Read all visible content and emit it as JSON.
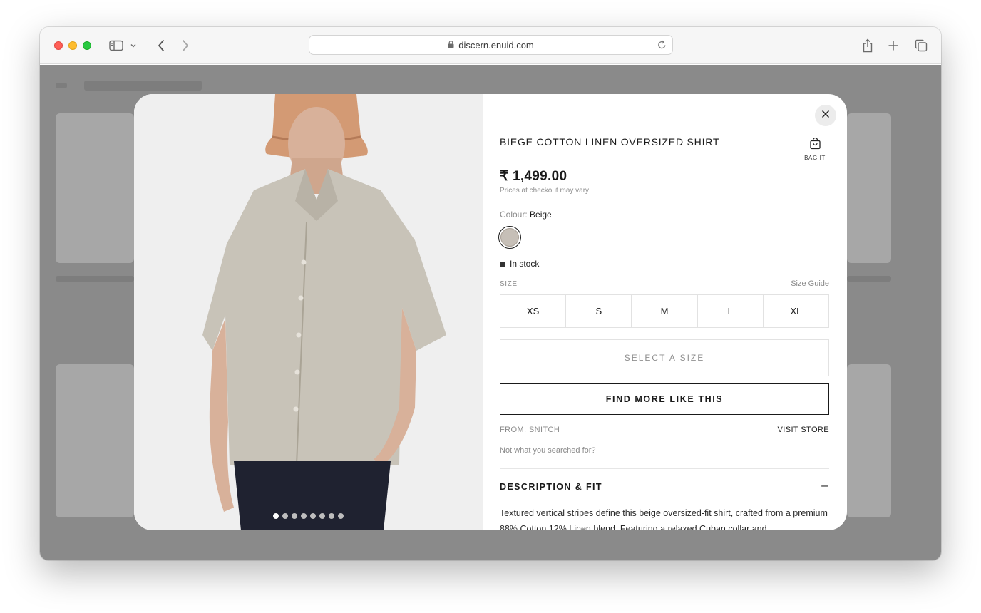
{
  "browser": {
    "url": "discern.enuid.com"
  },
  "product": {
    "title": "BIEGE COTTON LINEN OVERSIZED SHIRT",
    "bag_label": "BAG IT",
    "price": "₹ 1,499.00",
    "price_note": "Prices at checkout may vary",
    "colour_label": "Colour:",
    "colour_value": "Beige",
    "swatch_color": "#c6bfb7",
    "stock": "In stock",
    "size_label": "SIZE",
    "size_guide": "Size Guide",
    "sizes": [
      "XS",
      "S",
      "M",
      "L",
      "XL"
    ],
    "select_size": "SELECT A SIZE",
    "find_more": "FIND MORE LIKE THIS",
    "from": "FROM: SNITCH",
    "visit_store": "VISIT STORE",
    "not_what": "Not what you searched for?",
    "description_heading": "DESCRIPTION & FIT",
    "description_toggle": "–",
    "description": "Textured vertical stripes define this beige oversized-fit shirt, crafted from a premium 88% Cotton 12% Linen blend. Featuring a relaxed Cuban collar and",
    "image_count": 8,
    "active_image": 1
  },
  "icons": {
    "sidebar": "sidebar-icon",
    "back": "chevron-left-icon",
    "forward": "chevron-right-icon",
    "share": "share-icon",
    "new_tab": "plus-icon",
    "tabs": "tabs-icon",
    "close": "close-icon",
    "bag": "bag-icon"
  }
}
